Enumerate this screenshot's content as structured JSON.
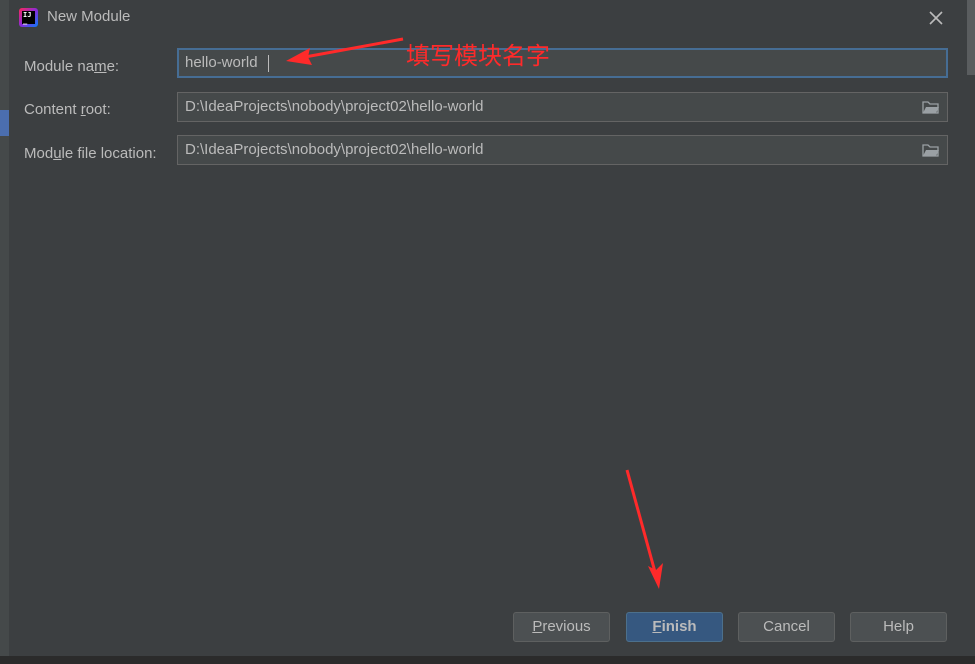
{
  "window": {
    "title": "New Module"
  },
  "form": {
    "module_name": {
      "label_pre": "Module na",
      "label_u": "m",
      "label_post": "e:",
      "value": "hello-world"
    },
    "content_root": {
      "label_pre": "Content ",
      "label_u": "r",
      "label_post": "oot:",
      "value": "D:\\IdeaProjects\\nobody\\project02\\hello-world"
    },
    "module_file_location": {
      "label_pre": "Mod",
      "label_u": "u",
      "label_post": "le file location:",
      "value": "D:\\IdeaProjects\\nobody\\project02\\hello-world"
    }
  },
  "buttons": {
    "previous_u": "P",
    "previous_rest": "revious",
    "finish_u": "F",
    "finish_rest": "inish",
    "cancel": "Cancel",
    "help": "Help"
  },
  "annotation": {
    "text": "填写模块名字",
    "color": "#ff2a2a"
  },
  "colors": {
    "background": "#3c3f41",
    "field": "#45494a",
    "focus_border": "#466d94",
    "primary_button": "#365880"
  }
}
